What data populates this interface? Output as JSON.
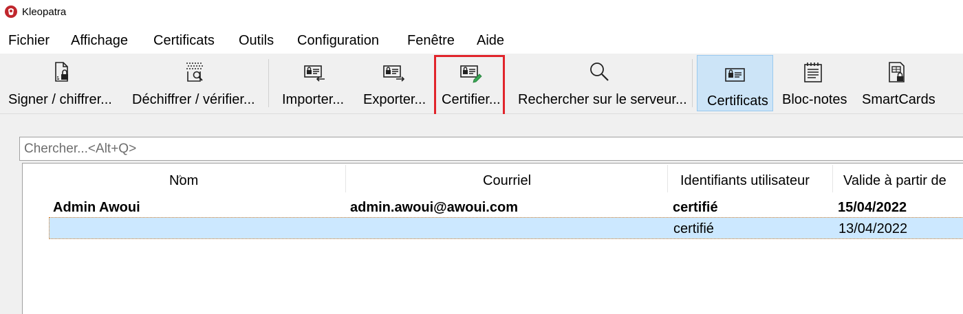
{
  "window": {
    "title": "Kleopatra"
  },
  "menu": [
    {
      "label": "Fichier"
    },
    {
      "label": "Affichage"
    },
    {
      "label": "Certificats"
    },
    {
      "label": "Outils"
    },
    {
      "label": "Configuration"
    },
    {
      "label": "Fenêtre"
    },
    {
      "label": "Aide"
    }
  ],
  "toolbar": {
    "sign_encrypt": "Signer / chiffrer...",
    "decrypt_verify": "Déchiffrer / vérifier...",
    "import": "Importer...",
    "export": "Exporter...",
    "certify": "Certifier...",
    "lookup": "Rechercher sur le serveur...",
    "certificates": "Certificats",
    "notepad": "Bloc-notes",
    "smartcards": "SmartCards"
  },
  "search": {
    "placeholder": "Chercher...<Alt+Q>"
  },
  "table": {
    "columns": [
      "Nom",
      "Courriel",
      "Identifiants utilisateur",
      "Valide à partir de"
    ],
    "rows": [
      {
        "name": "Admin Awoui",
        "email": "admin.awoui@awoui.com",
        "ids": "certifié",
        "valid_from": "15/04/2022"
      },
      {
        "name": "",
        "email": "",
        "ids": "certifié",
        "valid_from": "13/04/2022"
      }
    ]
  },
  "colors": {
    "selection": "#cce8ff",
    "active_tool": "#cce4f7",
    "highlight": "#e1242b"
  }
}
